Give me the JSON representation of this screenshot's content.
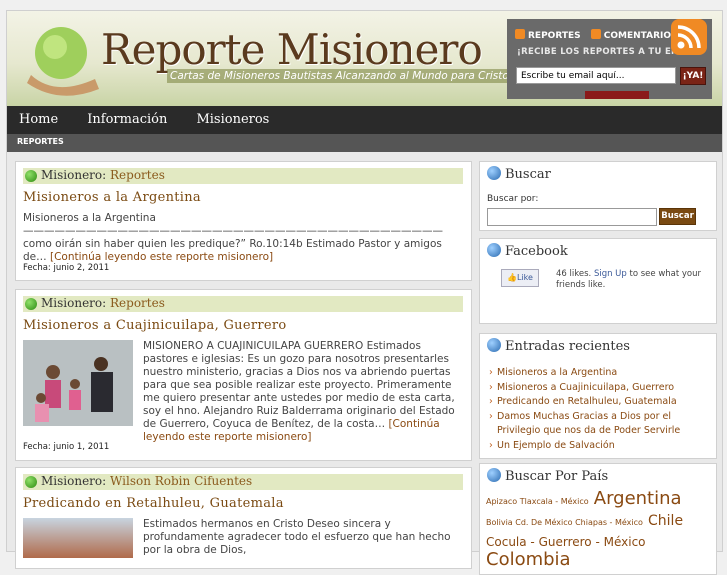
{
  "header": {
    "title": "Reporte Misionero",
    "tagline": "Cartas de Misioneros Bautistas Alcanzando al Mundo para Cristo"
  },
  "subscribe": {
    "reportes_label": "REPORTES",
    "comentarios_label": "COMENTARIOS",
    "caption": "¡RECIBE LOS REPORTES A TU EMAIL!",
    "email_placeholder": "Escribe tu email aquí...",
    "submit_label": "¡YA!"
  },
  "nav": {
    "items": [
      "Home",
      "Información",
      "Misioneros"
    ]
  },
  "subnav": {
    "label": "REPORTES"
  },
  "posts": [
    {
      "category_prefix": "Misionero:",
      "category": "Reportes",
      "title": "Misioneros a la Argentina",
      "excerpt_line1": "Misioneros a la Argentina",
      "excerpt_line2": "—————————————————————————————————————————————- y",
      "excerpt_line3": "como oirán sin haber quien les predique?” Ro.10:14b Estimado Pastor y amigos",
      "excerpt_line4": "de…",
      "more": "[Continúa leyendo este reporte misionero]",
      "date": "Fecha: junio 2, 2011"
    },
    {
      "category_prefix": "Misionero:",
      "category": "Reportes",
      "title": "Misioneros a Cuajinicuilapa, Guerrero",
      "excerpt": "MISIONERO A CUAJINICUILAPA GUERRERO   Estimados pastores e iglesias: Es un gozo para nosotros presentarles nuestro ministerio, gracias a Dios nos va abriendo puertas para que sea posible realizar este proyecto. Primeramente me quiero presentar ante ustedes por medio de esta carta, soy el hno. Alejandro Ruiz Balderrama originario del Estado de Guerrero, Coyuca de Benítez, de la costa…",
      "more": "[Continúa leyendo este reporte misionero]",
      "date": "Fecha: junio 1, 2011"
    },
    {
      "category_prefix": "Misionero:",
      "category": "Wilson Robin Cifuentes",
      "title": "Predicando en Retalhuleu, Guatemala",
      "excerpt": "Estimados hermanos en Cristo Deseo sincera y profundamente agradecer todo el esfuerzo que han hecho por la obra de Dios,"
    }
  ],
  "sidebar": {
    "search": {
      "heading": "Buscar",
      "label": "Buscar por:",
      "button": "Buscar"
    },
    "facebook": {
      "heading": "Facebook",
      "like_label": "Like",
      "likes_text": "46 likes.",
      "signup_text": "Sign Up",
      "rest_text": "to see what your friends like."
    },
    "recent": {
      "heading": "Entradas recientes",
      "items": [
        "Misioneros a la Argentina",
        "Misioneros a Cuajinicuilapa, Guerrero",
        "Predicando en Retalhuleu, Guatemala",
        "Damos Muchas Gracias a Dios por el Privilegio que nos da de Poder Servirle",
        "Un Ejemplo de Salvación"
      ]
    },
    "countries": {
      "heading": "Buscar Por País",
      "tags": [
        "Apizaco Tlaxcala - México",
        "Argentina",
        "Bolivia Cd. De México Chiapas - México",
        "Chile",
        "Cocula - Guerrero - México",
        "Colombia"
      ]
    }
  },
  "colors": {
    "accent": "#7a4a12",
    "nav_bg": "#2a2a2a",
    "category_bar": "#e2e9c2"
  }
}
